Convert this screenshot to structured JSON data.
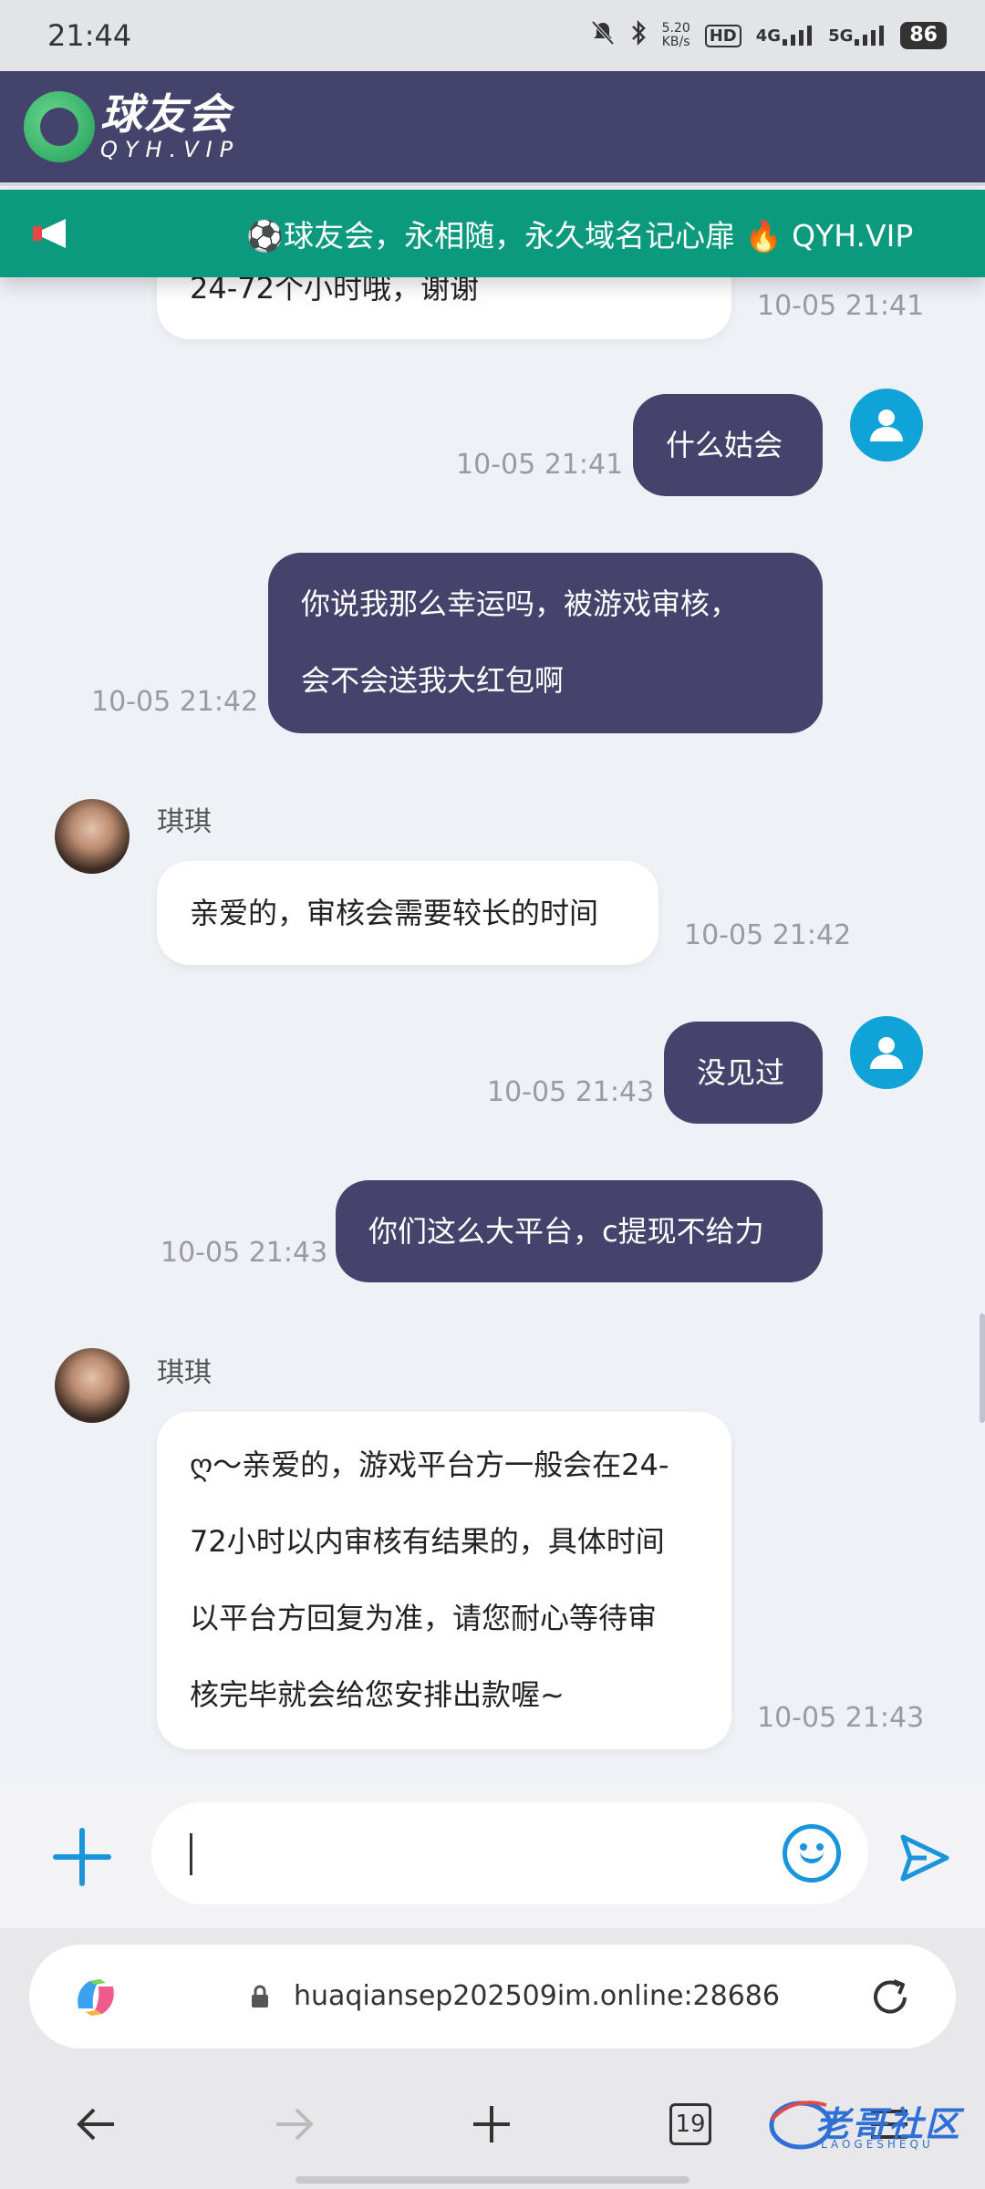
{
  "status_bar": {
    "time": "21:44",
    "net_speed_value": "5.20",
    "net_speed_unit": "KB/s",
    "hd": "HD",
    "signal_1": "4G",
    "signal_2": "5G",
    "battery": "86"
  },
  "brand": {
    "name_cn": "球友会",
    "name_en": "QYH.VIP"
  },
  "announcement": {
    "text": "⚽球友会，永相随，永久域名记心扉 🔥 QYH.VIP"
  },
  "messages": [
    {
      "side": "in",
      "lines": [
        "24-72个小时哦，谢谢"
      ],
      "time": "10-05 21:41"
    },
    {
      "side": "out",
      "lines": [
        "什么姑会"
      ],
      "time": "10-05 21:41"
    },
    {
      "side": "out",
      "lines": [
        "你说我那么幸运吗，被游戏审核，",
        "会不会送我大红包啊"
      ],
      "time": "10-05 21:42"
    },
    {
      "side": "in",
      "sender": "琪琪",
      "lines": [
        "亲爱的，审核会需要较长的时间"
      ],
      "time": "10-05 21:42"
    },
    {
      "side": "out",
      "lines": [
        "没见过"
      ],
      "time": "10-05 21:43"
    },
    {
      "side": "out",
      "lines": [
        "你们这么大平台，c提现不给力"
      ],
      "time": "10-05 21:43"
    },
    {
      "side": "in",
      "sender": "琪琪",
      "lines": [
        "ღ～亲爱的，游戏平台方一般会在24-",
        "72小时以内审核有结果的，具体时间",
        "以平台方回复为准，请您耐心等待审",
        "核完毕就会给您安排出款喔~"
      ],
      "time": "10-05 21:43"
    }
  ],
  "composer": {
    "input_value": "",
    "plus_icon": "plus-icon",
    "emoji_icon": "emoji-icon",
    "send_icon": "send-icon"
  },
  "browser": {
    "url": "huaqiansep202509im.online:28686",
    "tab_count": "19"
  },
  "watermark": {
    "text": "老哥社区",
    "sub": "LAOGESHEQU"
  },
  "colors": {
    "header": "#44436b",
    "announce": "#0c9a7e",
    "outgoing_bubble": "#45436b",
    "incoming_bubble": "#ffffff",
    "accent": "#1a95dc"
  }
}
